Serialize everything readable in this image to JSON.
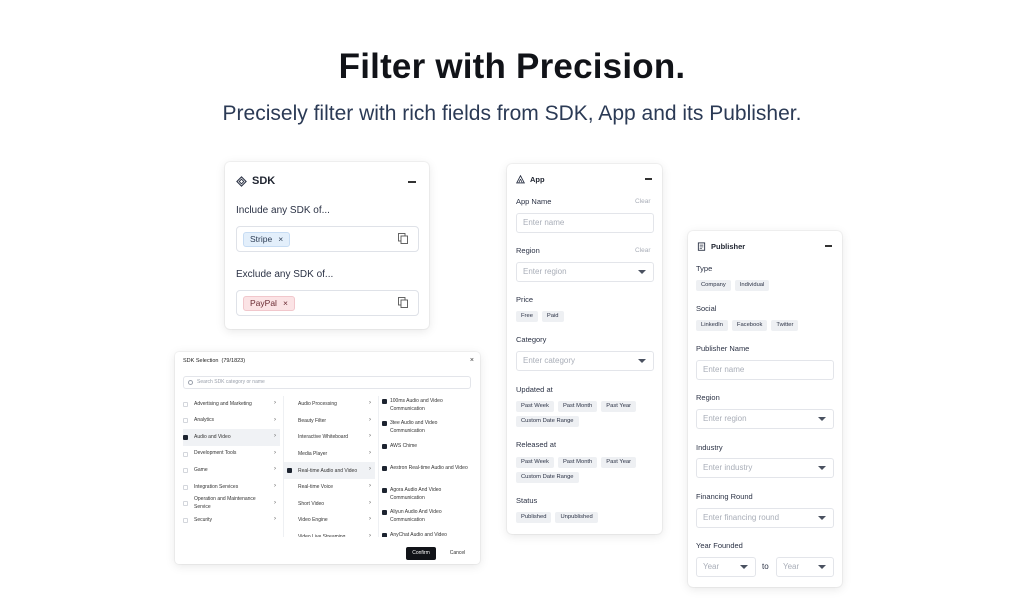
{
  "hero": {
    "title": "Filter with Precision.",
    "subtitle": "Precisely filter with rich fields from SDK, App and its Publisher."
  },
  "sdk_card": {
    "title": "SDK",
    "include_label": "Include any SDK of...",
    "include_tag": "Stripe",
    "exclude_label": "Exclude any SDK of...",
    "exclude_tag": "PayPal",
    "tag_remove": "×"
  },
  "modal": {
    "title": "SDK Selection",
    "count": "(79/1823)",
    "close": "×",
    "search_placeholder": "Search SDK category or name",
    "col1": [
      {
        "label": "Advertising and Marketing",
        "checked": false
      },
      {
        "label": "Analytics",
        "checked": false
      },
      {
        "label": "Audio and Video",
        "checked": true,
        "selected": true
      },
      {
        "label": "Development Tools",
        "checked": false
      },
      {
        "label": "Game",
        "checked": false
      },
      {
        "label": "Integration Services",
        "checked": false
      },
      {
        "label": "Operation and Maintenance Service",
        "checked": false
      },
      {
        "label": "Security",
        "checked": false
      }
    ],
    "col2": [
      {
        "label": "Audio Processing"
      },
      {
        "label": "Beauty Filter"
      },
      {
        "label": "Interactive Whiteboard"
      },
      {
        "label": "Media Player"
      },
      {
        "label": "Real-time Audio and Video",
        "selected": true
      },
      {
        "label": "Real-time Voice"
      },
      {
        "label": "Short Video"
      },
      {
        "label": "Video Engine"
      },
      {
        "label": "Video Live Streaming"
      }
    ],
    "col3": [
      "100ms Audio and Video Communication",
      "3tee Audio and Video Communication",
      "AWS Chime",
      "Aestron Real-time Audio and Video",
      "Agora Audio And Video Communication",
      "Aliyun Audio And Video Communication",
      "AnyChat Audio and Video Communication"
    ],
    "chevron": "›",
    "confirm": "Confirm",
    "cancel": "Cancel"
  },
  "app_card": {
    "title": "App",
    "app_name_label": "App Name",
    "clear": "Clear",
    "app_name_placeholder": "Enter name",
    "region_label": "Region",
    "region_placeholder": "Enter region",
    "price_label": "Price",
    "price_options": [
      "Free",
      "Paid"
    ],
    "category_label": "Category",
    "category_placeholder": "Enter category",
    "updated_label": "Updated at",
    "updated_options": [
      "Past Week",
      "Past Month",
      "Past Year"
    ],
    "updated_custom": "Custom Date Range",
    "released_label": "Released at",
    "released_options": [
      "Past Week",
      "Past Month",
      "Past Year"
    ],
    "released_custom": "Custom Date Range",
    "status_label": "Status",
    "status_options": [
      "Published",
      "Unpublished"
    ]
  },
  "publisher_card": {
    "title": "Publisher",
    "type_label": "Type",
    "type_options": [
      "Company",
      "Individual"
    ],
    "social_label": "Social",
    "social_options": [
      "LinkedIn",
      "Facebook",
      "Twitter"
    ],
    "name_label": "Publisher Name",
    "name_placeholder": "Enter name",
    "region_label": "Region",
    "region_placeholder": "Enter region",
    "industry_label": "Industry",
    "industry_placeholder": "Enter industry",
    "financing_label": "Financing Round",
    "financing_placeholder": "Enter financing round",
    "year_label": "Year Founded",
    "year_from": "Year",
    "to": "to",
    "year_to": "Year"
  }
}
